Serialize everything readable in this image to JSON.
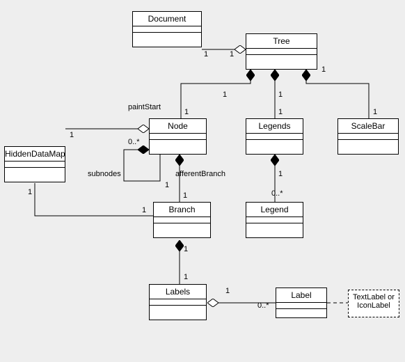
{
  "classes": {
    "document": "Document",
    "tree": "Tree",
    "node": "Node",
    "legends": "Legends",
    "scalebar": "ScaleBar",
    "hiddendatamap": "HiddenDataMap",
    "branch": "Branch",
    "legend": "Legend",
    "labels": "Labels",
    "label": "Label"
  },
  "note": "TextLabel or IconLabel",
  "assoc": {
    "paintStart": "paintStart",
    "subnodes": "subnodes",
    "afferentBranch": "afferentBranch"
  },
  "mult": {
    "one": "1",
    "zeroStar": "0..*"
  },
  "chart_data": {
    "type": "diagram",
    "diagram_type": "UML class diagram",
    "classes": [
      "Document",
      "Tree",
      "Node",
      "Legends",
      "ScaleBar",
      "HiddenDataMap",
      "Branch",
      "Legend",
      "Labels",
      "Label"
    ],
    "relationships": [
      {
        "from": "Tree",
        "to": "Document",
        "type": "aggregation",
        "labels": [
          "1",
          "1"
        ]
      },
      {
        "from": "Tree",
        "to": "Node",
        "type": "composition",
        "role": "paintStart",
        "labels": [
          "1",
          "1"
        ]
      },
      {
        "from": "Tree",
        "to": "Legends",
        "type": "composition",
        "labels": [
          "1",
          "1"
        ]
      },
      {
        "from": "Tree",
        "to": "ScaleBar",
        "type": "composition",
        "labels": [
          "1",
          "1"
        ]
      },
      {
        "from": "Node",
        "to": "HiddenDataMap",
        "type": "aggregation",
        "labels": [
          "1",
          "1"
        ]
      },
      {
        "from": "Node",
        "to": "Node",
        "type": "composition",
        "role": "subnodes",
        "labels": [
          "1",
          "0..*"
        ]
      },
      {
        "from": "Node",
        "to": "Branch",
        "type": "composition",
        "role": "afferentBranch",
        "labels": [
          "1",
          "1"
        ]
      },
      {
        "from": "Branch",
        "to": "HiddenDataMap",
        "type": "association",
        "labels": [
          "1",
          "1"
        ]
      },
      {
        "from": "Legends",
        "to": "Legend",
        "type": "composition",
        "labels": [
          "1",
          "0..*"
        ]
      },
      {
        "from": "Branch",
        "to": "Labels",
        "type": "composition",
        "labels": [
          "1",
          "1"
        ]
      },
      {
        "from": "Labels",
        "to": "Label",
        "type": "aggregation",
        "labels": [
          "1",
          "0..*"
        ]
      },
      {
        "from": "Label",
        "to": "Note",
        "type": "dependency",
        "note": "TextLabel or IconLabel"
      }
    ]
  }
}
